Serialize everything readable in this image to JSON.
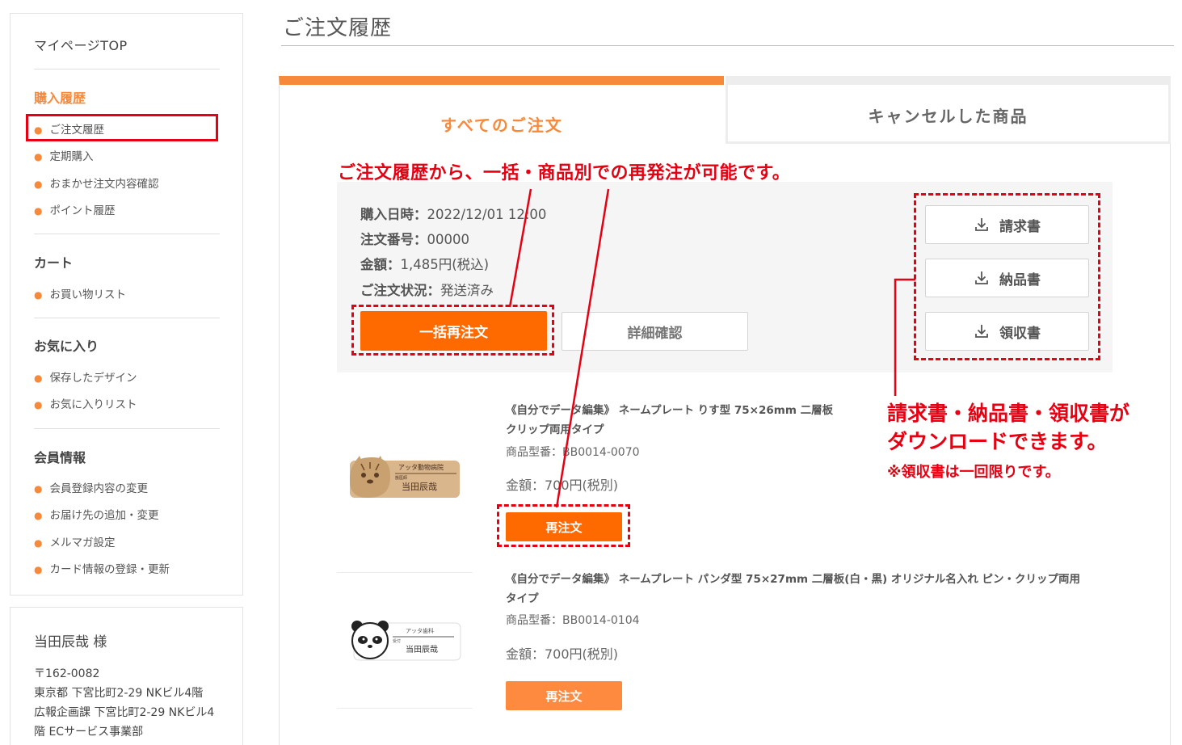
{
  "sidebar": {
    "mypage_top": "マイページTOP",
    "sections": [
      {
        "heading": "購入履歴",
        "items": [
          "ご注文履歴",
          "定期購入",
          "おまかせ注文内容確認",
          "ポイント履歴"
        ]
      },
      {
        "heading": "カート",
        "items": [
          "お買い物リスト"
        ]
      },
      {
        "heading": "お気に入り",
        "items": [
          "保存したデザイン",
          "お気に入りリスト"
        ]
      },
      {
        "heading": "会員情報",
        "items": [
          "会員登録内容の変更",
          "お届け先の追加・変更",
          "メルマガ設定",
          "カード情報の登録・更新"
        ]
      }
    ],
    "user": {
      "name": "当田辰哉 様",
      "address": "〒162-0082\n東京都 下宮比町2-29 NKビル4階\n広報企画課 下宮比町2-29 NKビル4階 ECサービス事業部"
    }
  },
  "page": {
    "title": "ご注文履歴",
    "tabs": [
      "すべてのご注文",
      "キャンセルした商品"
    ]
  },
  "order": {
    "date_label": "購入日時：",
    "date_value": "2022/12/01 12:00",
    "number_label": "注文番号：",
    "number_value": "00000",
    "amount_label": "金額：",
    "amount_value": "1,485円(税込)",
    "status_label": "ご注文状況：",
    "status_value": "発送済み",
    "bulk_reorder": "一括再注文",
    "detail": "詳細確認",
    "docs": {
      "invoice": "請求書",
      "delivery_note": "納品書",
      "receipt": "領収書"
    }
  },
  "products": [
    {
      "name_line1": "《自分でデータ編集》 ネームプレート りす型 75×26mm 二層板",
      "name_line2": "クリップ両用タイプ",
      "code": "商品型番：BB0014-0070",
      "price": "金額：700円(税別)",
      "reorder": "再注文",
      "plate_org": "アッタ動物病院",
      "plate_role": "獣医師",
      "plate_name": "当田辰哉"
    },
    {
      "name_line1": "《自分でデータ編集》 ネームプレート パンダ型 75×27mm 二層板(白・黒) オリジナル名入れ ピン・クリップ両用",
      "name_line2": "タイプ",
      "code": "商品型番：BB0014-0104",
      "price": "金額：700円(税別)",
      "reorder": "再注文",
      "plate_org": "アッタ歯科",
      "plate_role": "受付",
      "plate_name": "当田辰哉"
    }
  ],
  "annotations": {
    "top": "ご注文履歴から、一括・商品別での再発注が可能です。",
    "right_line1": "請求書・納品書・領収書が",
    "right_line2": "ダウンロードできます。",
    "right_note": "※領収書は一回限りです。"
  },
  "colors": {
    "accent": "#f7893b",
    "button": "#fe6a00",
    "annotation": "#e60012"
  }
}
